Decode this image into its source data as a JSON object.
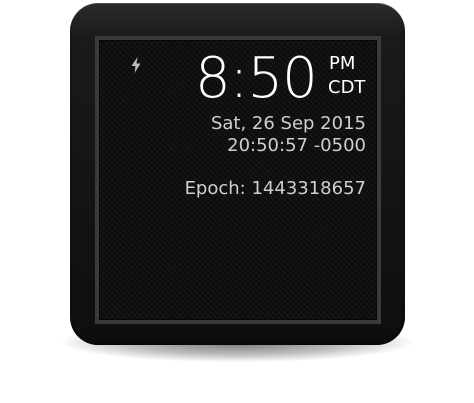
{
  "watch_face": {
    "time": "8:50",
    "am_pm": "PM",
    "timezone": "CDT",
    "date": "Sat, 26 Sep 2015",
    "time_24h": "20:50:57 -0500",
    "epoch": "Epoch: 1443318657",
    "charging_icon": "lightning-bolt-icon"
  },
  "colors": {
    "primary_text": "#ffffff",
    "secondary_text": "#cfcfcf",
    "screen_background": "#0f0f0f",
    "watch_body": "#141414"
  }
}
